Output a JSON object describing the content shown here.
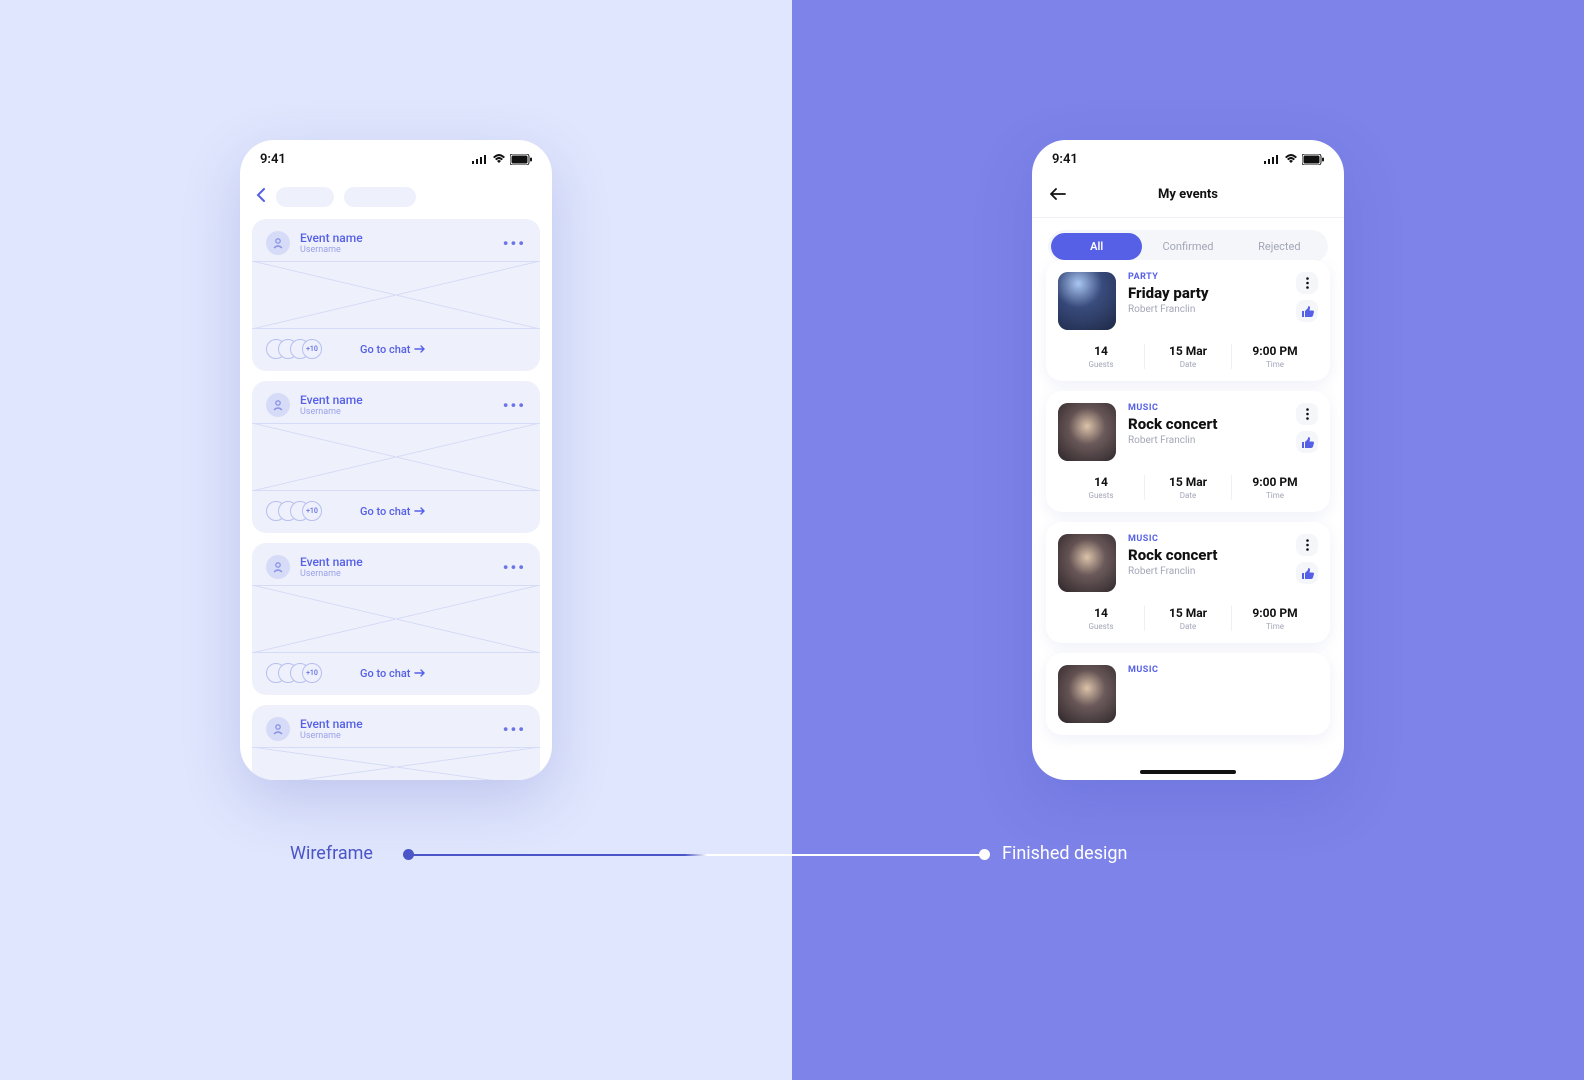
{
  "status": {
    "time": "9:41"
  },
  "wireframe": {
    "event_label": "Event name",
    "username_label": "Username",
    "overflow_count": "+10",
    "chat_label": "Go to chat"
  },
  "finished": {
    "title": "My events",
    "tabs": [
      {
        "label": "All",
        "active": true
      },
      {
        "label": "Confirmed",
        "active": false
      },
      {
        "label": "Rejected",
        "active": false
      }
    ],
    "meta_labels": {
      "guests": "Guests",
      "date": "Date",
      "time": "Time"
    },
    "events": [
      {
        "category": "PARTY",
        "name": "Friday party",
        "organizer": "Robert Franclin",
        "guests": "14",
        "date": "15 Mar",
        "time": "9:00 PM",
        "img": "party"
      },
      {
        "category": "MUSIC",
        "name": "Rock concert",
        "organizer": "Robert Franclin",
        "guests": "14",
        "date": "15 Mar",
        "time": "9:00 PM",
        "img": "music"
      },
      {
        "category": "MUSIC",
        "name": "Rock concert",
        "organizer": "Robert Franclin",
        "guests": "14",
        "date": "15 Mar",
        "time": "9:00 PM",
        "img": "music"
      },
      {
        "category": "MUSIC",
        "name": "",
        "organizer": "",
        "guests": "",
        "date": "",
        "time": "",
        "img": "music"
      }
    ]
  },
  "captions": {
    "left": "Wireframe",
    "right": "Finished design"
  }
}
